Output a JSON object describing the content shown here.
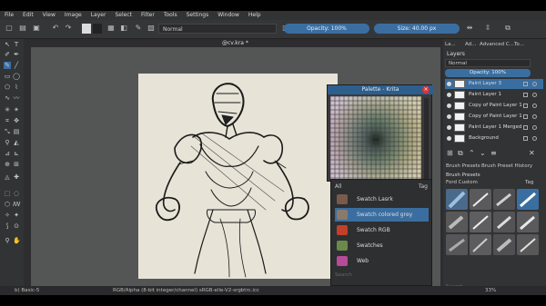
{
  "menubar": {
    "items": [
      "File",
      "Edit",
      "View",
      "Image",
      "Layer",
      "Select",
      "Filter",
      "Tools",
      "Settings",
      "Window",
      "Help"
    ]
  },
  "toolbar": {
    "blend_mode": "Normal",
    "opacity_label": "Opacity: 100%",
    "opacity_value": 1.0,
    "size_label": "Size: 40.00 px"
  },
  "document": {
    "tab_title": "@cv.kra *"
  },
  "palette": {
    "title": "Palette - Krita",
    "close_glyph": "×"
  },
  "presets": {
    "filter": "All",
    "tag_label": "Tag",
    "items": [
      {
        "label": "Swatch Lasrk",
        "color": "#7a5a4a"
      },
      {
        "label": "Swatch colored grey",
        "color": "#8a7a6a"
      },
      {
        "label": "Swatch RGB",
        "color": "#c0402a"
      },
      {
        "label": "Swatches",
        "color": "#6a8a4a"
      },
      {
        "label": "Web",
        "color": "#b84a9a"
      }
    ],
    "search_placeholder": "Search"
  },
  "docker": {
    "tabs": [
      "La...",
      "Ad...",
      "Advanced C...",
      "To..."
    ],
    "layers_title": "Layers",
    "blend_mode": "Normal",
    "opacity_label": "Opacity: 100%",
    "layers": [
      {
        "name": "Paint Layer 3",
        "selected": true
      },
      {
        "name": "Paint Layer 1",
        "selected": false
      },
      {
        "name": "Copy of Paint Layer 1",
        "selected": false
      },
      {
        "name": "Copy of Paint Layer 1",
        "selected": false
      },
      {
        "name": "Paint Layer 1 Merged",
        "selected": false
      },
      {
        "name": "Background",
        "selected": false
      }
    ],
    "brush_tabs": [
      "Brush Presets",
      "Brush Preset History"
    ],
    "brush_presets_title": "Brush Presets",
    "brush_tag": "Ford Custom",
    "brush_tag_button": "Tag",
    "brush_search_placeholder": "Search",
    "zoom": "33%"
  },
  "statusbar": {
    "brush": "b) Basic-5",
    "color_info": "RGB/Alpha (8-bit integer/channel)  sRGB-elle-V2-srgbtrc.icc"
  },
  "colors": {
    "accent": "#3b6ea0",
    "selection": "#2c5f8e",
    "panel": "#323335",
    "canvas": "#545656",
    "paper": "#e7e3d7"
  }
}
